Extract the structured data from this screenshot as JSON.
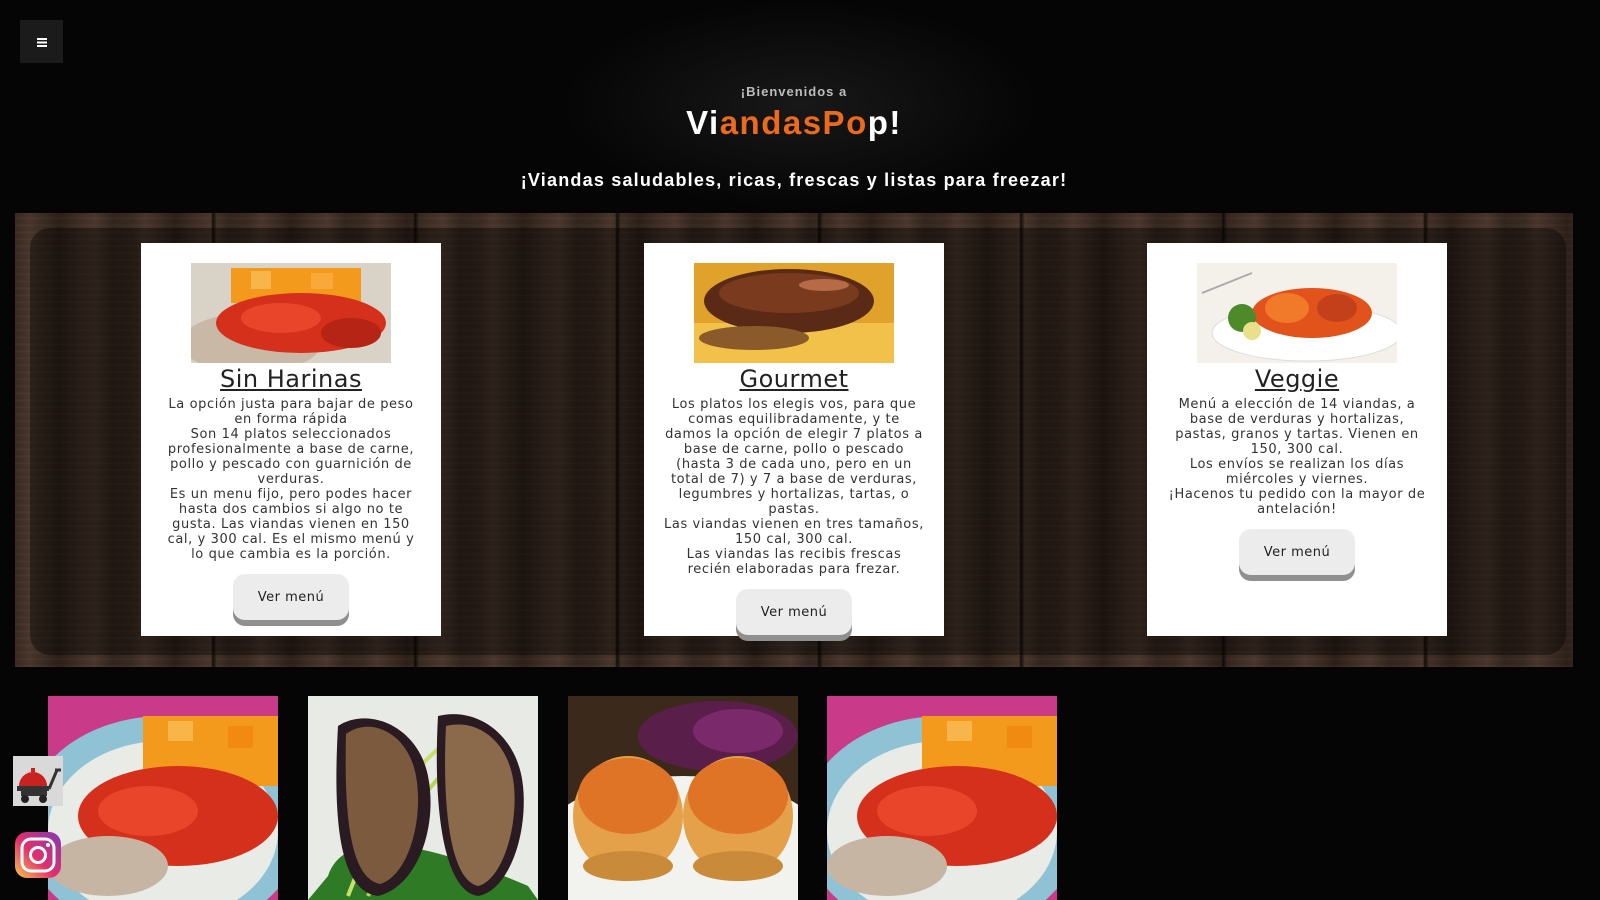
{
  "nav": {
    "menu_icon": "hamburger-icon"
  },
  "hero": {
    "welcome": "¡Bienvenidos a",
    "brand_parts": [
      "Vi",
      "andasPo",
      "p!"
    ],
    "tagline": "¡Viandas saludables, ricas, frescas y listas para freezar!"
  },
  "cards": [
    {
      "title": "Sin Harinas",
      "description": [
        "La opción justa para bajar de peso en forma rápida",
        "Son 14 platos seleccionados profesionalmente a base de carne, pollo y pescado con guarnición de verduras.",
        "Es un menu fijo, pero podes hacer hasta dos cambios si algo no te gusta. Las viandas vienen en 150 cal, y 300 cal. Es el mismo menú y lo que cambia es la porción."
      ],
      "button": "Ver menú"
    },
    {
      "title": "Gourmet",
      "description": [
        "Los platos los elegis vos, para que comas equilibradamente, y te damos la opción de elegir 7 platos a base de carne, pollo o pescado (hasta 3 de cada uno, pero en un total de 7) y 7 a base de verduras, legumbres y hortalizas, tartas, o pastas.",
        "Las viandas vienen en tres tamaños, 150 cal, 300 cal.",
        "Las viandas las recibis frescas recién elaboradas para frezar."
      ],
      "button": "Ver menú"
    },
    {
      "title": "Veggie",
      "description": [
        "Menú a elección de 14 viandas, a base de verduras y hortalizas, pastas, granos y tartas. Vienen en 150, 300 cal.",
        "Los envíos se realizan los días miércoles y viernes.",
        "¡Hacenos tu pedido con la mayor de antelación!"
      ],
      "button": "Ver menú"
    }
  ],
  "side": {
    "delivery_icon": "delivery-cart-icon",
    "social_icon": "instagram-icon"
  },
  "colors": {
    "accent": "#ea6a1e",
    "background": "#050505",
    "card": "#ffffff"
  }
}
